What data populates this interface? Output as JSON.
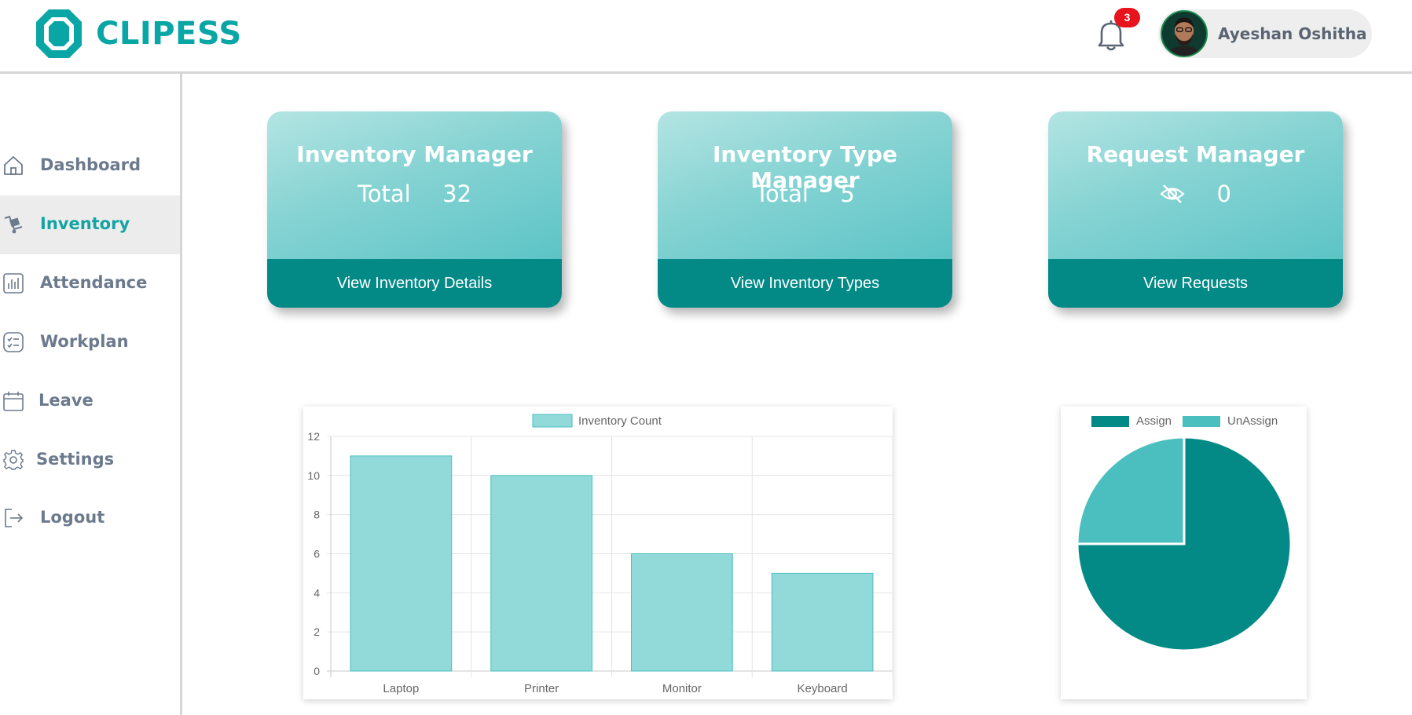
{
  "app": {
    "logo_text": "CLIPESS",
    "brand_color": "#0aa6a6"
  },
  "header": {
    "notification_count": "3",
    "user_name": "Ayeshan Oshitha"
  },
  "sidebar": {
    "items": [
      {
        "label": "Dashboard",
        "icon": "home-icon"
      },
      {
        "label": "Inventory",
        "icon": "inventory-icon",
        "active": true
      },
      {
        "label": "Attendance",
        "icon": "bar-chart-icon"
      },
      {
        "label": "Workplan",
        "icon": "checklist-icon"
      },
      {
        "label": "Leave",
        "icon": "calendar-icon"
      },
      {
        "label": "Settings",
        "icon": "gear-icon"
      },
      {
        "label": "Logout",
        "icon": "logout-icon"
      }
    ]
  },
  "cards": [
    {
      "title": "Inventory Manager",
      "stat_label": "Total",
      "stat_value": "32",
      "button": "View Inventory Details"
    },
    {
      "title": "Inventory Type Manager",
      "stat_label": "Total",
      "stat_value": "5",
      "button": "View Inventory Types"
    },
    {
      "title": "Request Manager",
      "stat_icon": "eye-slash-icon",
      "stat_value": "0",
      "button": "View Requests"
    }
  ],
  "colors": {
    "teal_dark": "#038a87",
    "teal_bar": "#92d9d9",
    "teal_light": "#4bbfbf"
  },
  "chart_data": [
    {
      "type": "bar",
      "categories": [
        "Laptop",
        "Printer",
        "Monitor",
        "Keyboard"
      ],
      "series": [
        {
          "name": "Inventory Count",
          "values": [
            11,
            10,
            6,
            5
          ]
        }
      ],
      "ylim": [
        0,
        12
      ],
      "yticks": [
        0,
        2,
        4,
        6,
        8,
        10,
        12
      ],
      "grid": true,
      "legend": "top-center"
    },
    {
      "type": "pie",
      "labels": [
        "Assign",
        "UnAssign"
      ],
      "values": [
        75,
        25
      ],
      "colors": [
        "#038a87",
        "#4bbfbf"
      ],
      "legend": "top-center"
    }
  ]
}
